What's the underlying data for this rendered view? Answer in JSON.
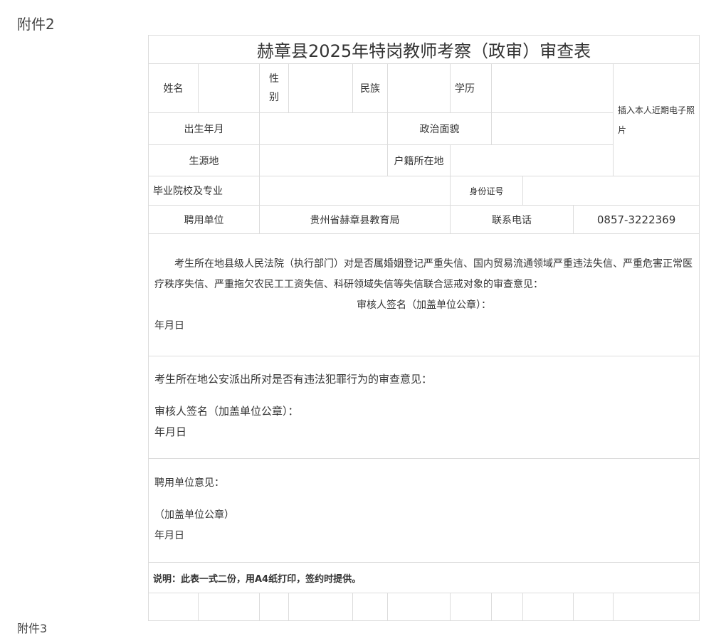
{
  "attachment_label": "附件2",
  "next_attachment_label": "附件3",
  "form": {
    "title": "赫章县2025年特岗教师考察（政审）审查表",
    "labels": {
      "name": "姓名",
      "gender": "性别",
      "ethnicity": "民族",
      "education": "学历",
      "photo": "插入本人近期电子照片",
      "birth": "出生年月",
      "political": "政治面貌",
      "origin": "生源地",
      "household": "户籍所在地",
      "school": "毕业院校及专业",
      "id_number": "身份证号",
      "employer": "聘用单位",
      "phone": "联系电话"
    },
    "values": {
      "employer": "贵州省赫章县教育局",
      "phone": "0857-3222369"
    },
    "court_section": {
      "text": "考生所在地县级人民法院（执行部门）对是否属婚姻登记严重失信、国内贸易流通领域严重违法失信、严重危害正常医疗秩序失信、严重拖欠农民工工资失信、科研领域失信等失信联合惩戒对象的审查意见：",
      "signature": "审核人签名（加盖单位公章）：",
      "date": "年月日"
    },
    "police_section": {
      "text": "考生所在地公安派出所对是否有违法犯罪行为的审查意见：",
      "signature": "审核人签名（加盖单位公章）：",
      "date": "年月日"
    },
    "employer_section": {
      "text": "聘用单位意见：",
      "seal": "（加盖单位公章）",
      "date": "年月日"
    },
    "note": "说明：此表一式二份，用A4纸打印，签约时提供。"
  }
}
